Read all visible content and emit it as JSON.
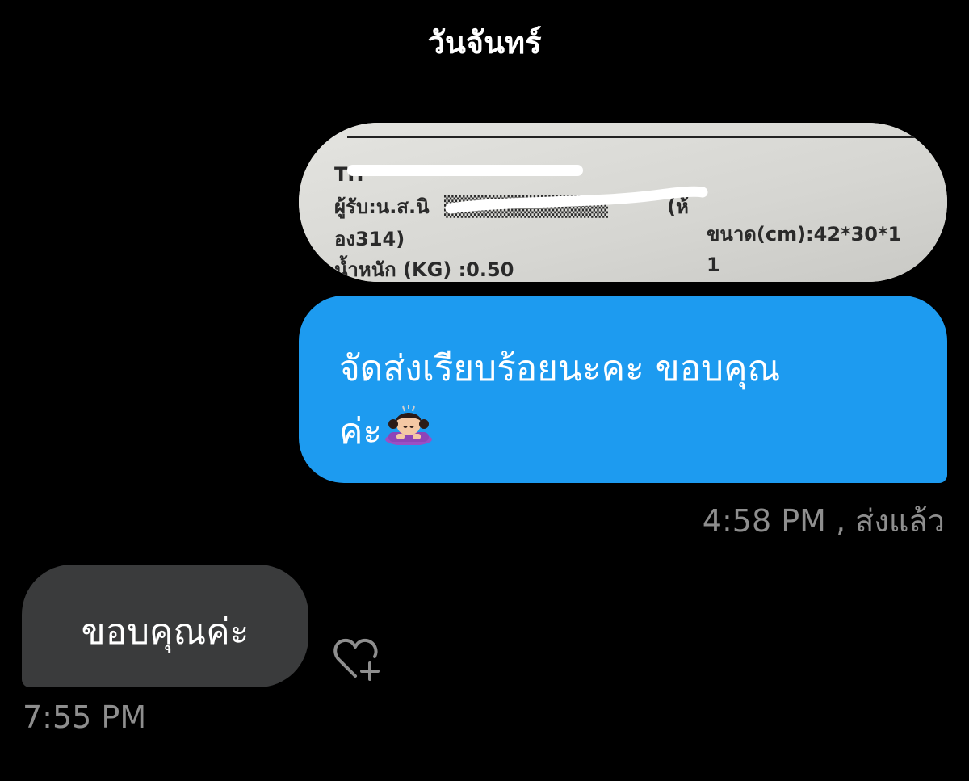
{
  "header": {
    "day_label": "วันจันทร์"
  },
  "sent_photo": {
    "receipt_lines": {
      "line1": "TH",
      "line2": "ผู้รับ:น.ส.นิ",
      "line2_tail": "(ห้",
      "line3": "อง314)",
      "size_label": "ขนาด(cm):42*30*1",
      "size_cont": "1",
      "weight_label": "น้ำหนัก (KG) :0.50"
    }
  },
  "sent_message": {
    "line1": "จัดส่งเรียบร้อยนะคะ ขอบคุณ",
    "line2": "ค่ะ",
    "emoji": "person-bowing-emoji",
    "meta": "4:58 PM , ส่งแล้ว",
    "bubble_color": "#1d9bf0"
  },
  "received_message": {
    "text": "ขอบคุณค่ะ",
    "time": "7:55 PM",
    "bubble_color": "#3a3b3c"
  },
  "reaction": {
    "icon": "heart-plus-icon"
  }
}
